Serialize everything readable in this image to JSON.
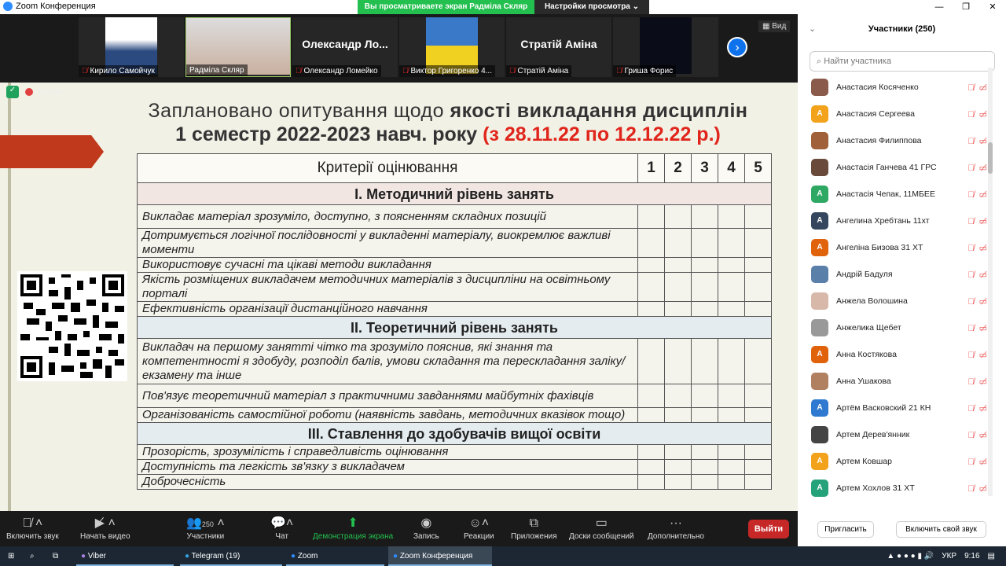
{
  "window": {
    "title": "Zoom Конференция",
    "banner": "Вы просматриваете экран Радміла Скляр",
    "view_options": "Настройки просмотра ⌄"
  },
  "gallery": {
    "tiles": [
      {
        "name": "Кирило Самойчук",
        "muted": true,
        "big": ""
      },
      {
        "name": "Радміла Скляр",
        "muted": false,
        "big": ""
      },
      {
        "name": "Олександр Ломейко",
        "muted": true,
        "big": "Олександр  Ло..."
      },
      {
        "name": "Виктор Григоренко 4...",
        "muted": true,
        "big": ""
      },
      {
        "name": "Стратій Аміна",
        "muted": true,
        "big": "Стратій Аміна"
      },
      {
        "name": "Гриша Форис",
        "muted": true,
        "big": ""
      }
    ],
    "view_label": "Вид",
    "recording": "Запись"
  },
  "slide": {
    "title1_plain": "Заплановано опитування щодо ",
    "title1_bold": "якості викладання дисциплін",
    "title2_plain": "1 семестр 2022-2023 навч. року ",
    "title2_red": "(з 28.11.22 по 12.12.22 р.)",
    "table": {
      "header": "Критерії оцінювання",
      "scores": [
        "1",
        "2",
        "3",
        "4",
        "5"
      ],
      "sections": [
        {
          "title": "І. Методичний рівень занять",
          "rows": [
            "Викладає матеріал зрозуміло, доступно, з поясненням складних позицій",
            "Дотримується логічної послідовності у викладенні матеріалу, виокремлює важливі моменти",
            "Використовує сучасні та цікаві методи викладання",
            "Якість розміщених викладачем методичних матеріалів з дисципліни на освітньому порталі",
            "Ефективність організації дистанційного навчання"
          ]
        },
        {
          "title": "ІІ. Теоретичний рівень занять",
          "rows": [
            "Викладач на першому занятті чітко та зрозуміло пояснив, які знання та компетентності я здобуду, розподіл балів, умови складання та перескладання заліку/екзамену та інше",
            "Пов'язує теоретичний матеріал з практичними завданнями майбутніх фахівців",
            "Організованість самостійної роботи (наявність завдань, методичних вказівок тощо)"
          ]
        },
        {
          "title": "ІІІ. Ставлення до здобувачів вищої освіти",
          "rows": [
            "Прозорість, зрозумілість і справедливість оцінювання",
            "Доступність та легкість зв'язку з викладачем",
            "Доброчесність"
          ]
        }
      ]
    }
  },
  "toolbar": {
    "audio": "Включить звук",
    "video": "Начать видео",
    "participants": "Участники",
    "participants_count": "250",
    "chat": "Чат",
    "share": "Демонстрация экрана",
    "record": "Запись",
    "reactions": "Реакции",
    "apps": "Приложения",
    "whiteboards": "Доски сообщений",
    "more": "Дополнительно",
    "leave": "Выйти"
  },
  "panel": {
    "title": "Участники (250)",
    "search_placeholder": "Найти участника",
    "invite": "Пригласить",
    "unmute_me": "Включить свой звук",
    "participants": [
      {
        "name": "Анастасия Косяченко",
        "initial": "",
        "color": "#8a5a4a"
      },
      {
        "name": "Анастасия Сергеева",
        "initial": "A",
        "color": "#f2a31b"
      },
      {
        "name": "Анастасия Филиппова",
        "initial": "",
        "color": "#a0603a"
      },
      {
        "name": "Анастасія Ганчева 41 ГРС",
        "initial": "",
        "color": "#6a4a3a"
      },
      {
        "name": "Анастасія Чепак, 11МБЕЕ",
        "initial": "A",
        "color": "#2ea863"
      },
      {
        "name": "Ангелина Хребтань 11хт",
        "initial": "A",
        "color": "#34475e"
      },
      {
        "name": "Ангеліна Бизова 31 ХТ",
        "initial": "A",
        "color": "#e0620b"
      },
      {
        "name": "Андрій Бадуля",
        "initial": "",
        "color": "#5a7fa8"
      },
      {
        "name": "Анжела Волошина",
        "initial": "",
        "color": "#d8b8a8"
      },
      {
        "name": "Анжелика Щебет",
        "initial": "",
        "color": "#999"
      },
      {
        "name": "Анна Костякова",
        "initial": "A",
        "color": "#e0620b"
      },
      {
        "name": "Анна Ушакова",
        "initial": "",
        "color": "#b08060"
      },
      {
        "name": "Артём Васковский 21 КН",
        "initial": "A",
        "color": "#2f7ad0"
      },
      {
        "name": "Артем Дерев'янник",
        "initial": "",
        "color": "#444"
      },
      {
        "name": "Артем Ковшар",
        "initial": "A",
        "color": "#f2a31b"
      },
      {
        "name": "Артем Хохлов 31 ХТ",
        "initial": "A",
        "color": "#25a27a"
      }
    ]
  },
  "taskbar": {
    "items": [
      "Viber",
      "Telegram (19)",
      "Zoom",
      "Zoom Конференция"
    ],
    "lang": "УКР",
    "time": "9:16"
  }
}
